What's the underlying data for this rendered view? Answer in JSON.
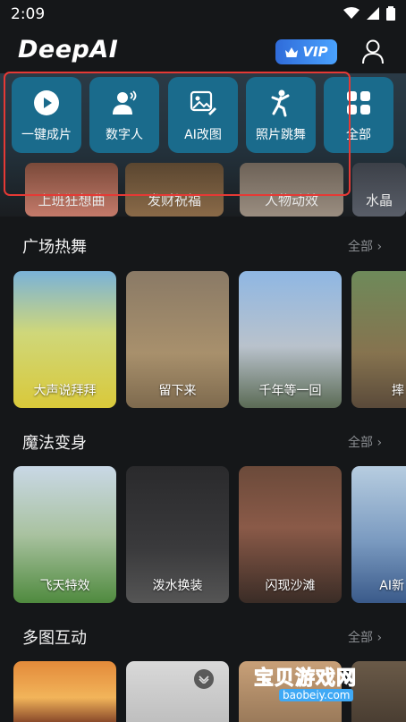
{
  "status": {
    "time": "2:09"
  },
  "header": {
    "logo": "DeepAI",
    "vip_label": "VIP"
  },
  "quick_actions": [
    {
      "label": "一键成片",
      "icon": "play-icon"
    },
    {
      "label": "数字人",
      "icon": "digital-human-icon"
    },
    {
      "label": "AI改图",
      "icon": "image-edit-icon"
    },
    {
      "label": "照片跳舞",
      "icon": "dance-icon"
    },
    {
      "label": "全部",
      "icon": "grid-icon"
    }
  ],
  "hero_captions": [
    "上班狂想曲",
    "发财祝福",
    "人物动效",
    "水晶"
  ],
  "sections": [
    {
      "title": "广场热舞",
      "more": "全部",
      "items": [
        "大声说拜拜",
        "留下来",
        "千年等一回",
        "摔"
      ]
    },
    {
      "title": "魔法变身",
      "more": "全部",
      "items": [
        "飞天特效",
        "泼水换装",
        "闪现沙滩",
        "AI新"
      ]
    },
    {
      "title": "多图互动",
      "more": "全部",
      "items": [
        "",
        "",
        "",
        ""
      ]
    }
  ],
  "watermark": {
    "line1": "宝贝游戏网",
    "line2": "baobeiy.com"
  },
  "colors": {
    "background": "#151719",
    "quick_tile": "#1a6b8c",
    "vip": "#3a86f0",
    "highlight_box": "#e53935"
  }
}
